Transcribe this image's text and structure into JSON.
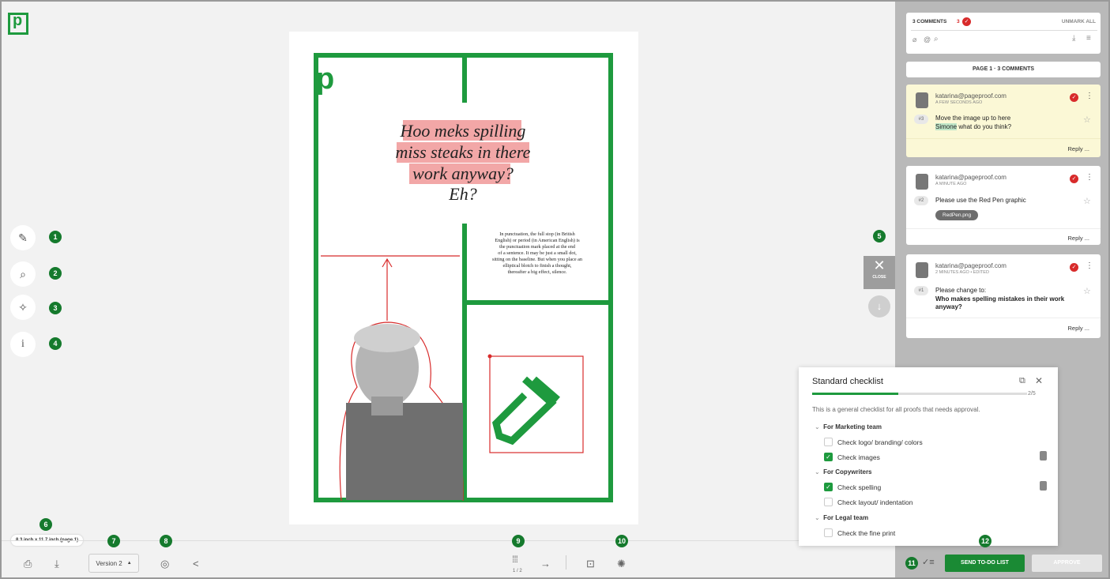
{
  "document": {
    "headline_lines": [
      "Hoo meks spilling",
      "miss steaks in there",
      "work anyway?"
    ],
    "headline_tail": "Eh?",
    "body_lines": [
      "In punctuation, the full stop (in British",
      "English) or period (in American English) is",
      "the punctuation mark placed at the end",
      "of a sentence.  It may be just a small dot,",
      "sitting on the baseline. But when you place an",
      "elliptical blotch to finish a thought,",
      "thereafter a big effect, silence."
    ],
    "size_label": "8.3 inch x 11.7 inch (page 1)"
  },
  "badges": [
    "1",
    "2",
    "3",
    "4",
    "5",
    "6",
    "7",
    "8",
    "9",
    "10",
    "11",
    "12"
  ],
  "toolbar": {
    "version_label": "Version 2",
    "page_counter": "1 / 2"
  },
  "comments_header": {
    "count_label": "3 COMMENTS",
    "resolved_count": "3",
    "unmark_label": "UNMARK ALL",
    "page_label": "PAGE 1  ·  3 COMMENTS"
  },
  "comments": [
    {
      "email": "katarina@pageproof.com",
      "time": "A FEW SECONDS AGO",
      "num": "#3",
      "text1": "Move the image up to here",
      "mention": "Simone",
      "text2": " what do you think?",
      "reply": "Reply ..."
    },
    {
      "email": "katarina@pageproof.com",
      "time": "A MINUTE AGO",
      "num": "#2",
      "text1": "Please use the Red Pen graphic",
      "attachment": "RedPen.png",
      "reply": "Reply ..."
    },
    {
      "email": "katarina@pageproof.com",
      "time": "2 MINUTES AGO  •  EDITED",
      "num": "#1",
      "text1": "Please change to:",
      "bold": "Who makes spelling mistakes in their work anyway?",
      "reply": "Reply ..."
    }
  ],
  "close_label": "CLOSE",
  "checklist": {
    "title": "Standard checklist",
    "progress": "2/5",
    "progress_fraction": 0.4,
    "description": "This is a general checklist for all proofs that needs approval.",
    "sections": [
      {
        "name": "For Marketing team",
        "items": [
          {
            "label": "Check logo/ branding/ colors",
            "checked": false
          },
          {
            "label": "Check images",
            "checked": true
          }
        ]
      },
      {
        "name": "For Copywriters",
        "items": [
          {
            "label": "Check spelling",
            "checked": true
          },
          {
            "label": "Check layout/ indentation",
            "checked": false
          }
        ]
      },
      {
        "name": "For Legal team",
        "items": [
          {
            "label": "Check the fine print",
            "checked": false
          }
        ]
      }
    ]
  },
  "actions": {
    "send": "SEND TO-DO LIST",
    "approve": "APPROVE"
  },
  "colors": {
    "brand": "#1e9a3e",
    "highlight": "#f2a7a7",
    "pen": "#d82b2b"
  }
}
